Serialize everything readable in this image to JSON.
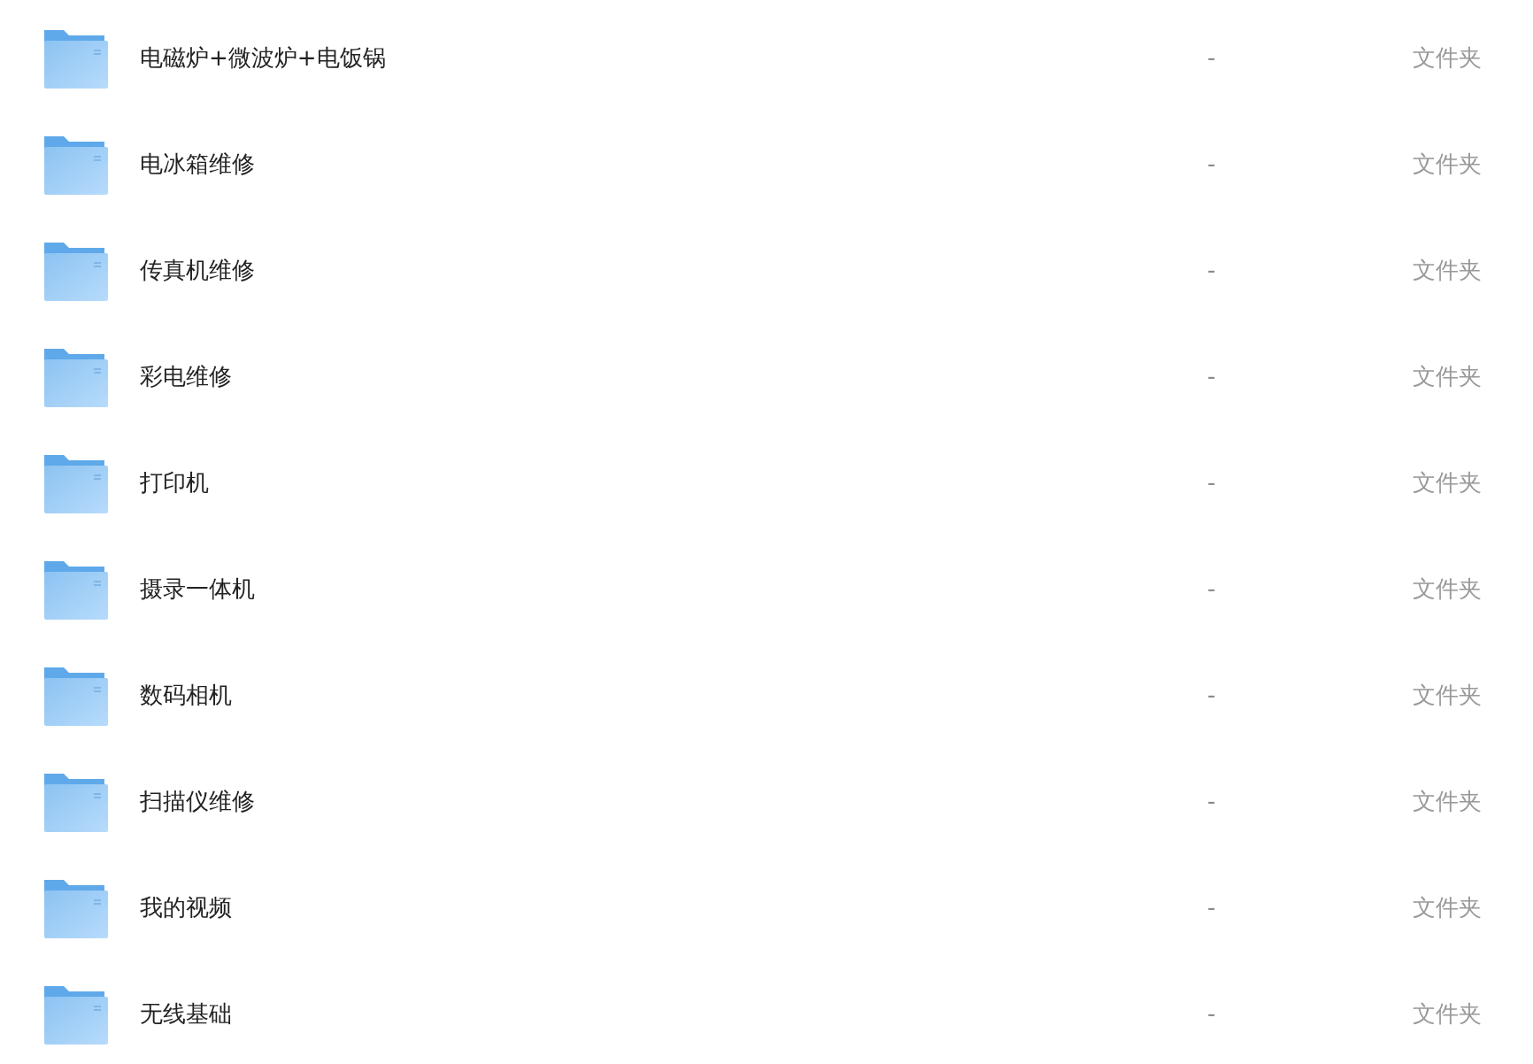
{
  "files": [
    {
      "name": "电磁炉+微波炉+电饭锅",
      "size": "-",
      "type": "文件夹"
    },
    {
      "name": "电冰箱维修",
      "size": "-",
      "type": "文件夹"
    },
    {
      "name": "传真机维修",
      "size": "-",
      "type": "文件夹"
    },
    {
      "name": "彩电维修",
      "size": "-",
      "type": "文件夹"
    },
    {
      "name": "打印机",
      "size": "-",
      "type": "文件夹"
    },
    {
      "name": "摄录一体机",
      "size": "-",
      "type": "文件夹"
    },
    {
      "name": "数码相机",
      "size": "-",
      "type": "文件夹"
    },
    {
      "name": "扫描仪维修",
      "size": "-",
      "type": "文件夹"
    },
    {
      "name": "我的视频",
      "size": "-",
      "type": "文件夹"
    },
    {
      "name": "无线基础",
      "size": "-",
      "type": "文件夹"
    }
  ]
}
